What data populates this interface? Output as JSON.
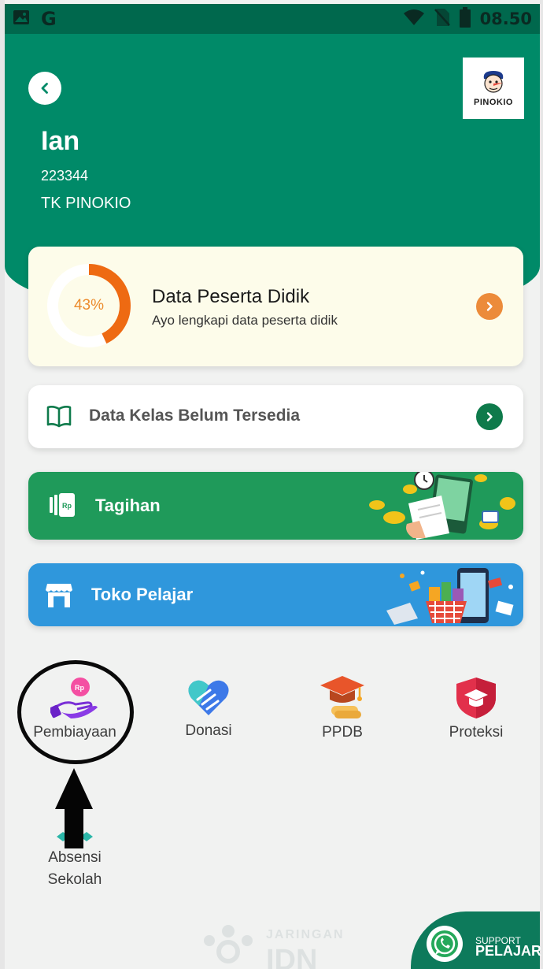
{
  "status_bar": {
    "time": "08.50",
    "left_icons": [
      "image-icon",
      "google-icon"
    ],
    "right_icons": [
      "wifi-icon",
      "no-sim-icon",
      "battery-icon"
    ]
  },
  "header": {
    "user_name": "Ian",
    "user_id": "223344",
    "school_name": "TK PINOKIO",
    "school_logo_text": "PINOKIO",
    "background_color": "#008a68"
  },
  "progress_card": {
    "percent_label": "43%",
    "percent_value": 43,
    "title": "Data Peserta Didik",
    "subtitle": "Ayo lengkapi data peserta didik",
    "accent_color": "#ec8b3a"
  },
  "class_card": {
    "label": "Data Kelas Belum Tersedia"
  },
  "tagihan_card": {
    "label": "Tagihan"
  },
  "toko_card": {
    "label": "Toko Pelajar"
  },
  "menu": [
    {
      "label": "Pembiayaan",
      "icon": "payment-hand-icon"
    },
    {
      "label": "Donasi",
      "icon": "donation-heart-icon"
    },
    {
      "label": "PPDB",
      "icon": "graduation-cap-icon"
    },
    {
      "label": "Proteksi",
      "icon": "protection-shield-icon"
    },
    {
      "label_line1": "Absensi",
      "label_line2": "Sekolah",
      "icon": "attendance-icon"
    }
  ],
  "footer": {
    "watermark_small": "JARINGAN",
    "watermark_big": "IDN",
    "support_small": "SUPPORT",
    "support_big": "PELAJAR"
  }
}
